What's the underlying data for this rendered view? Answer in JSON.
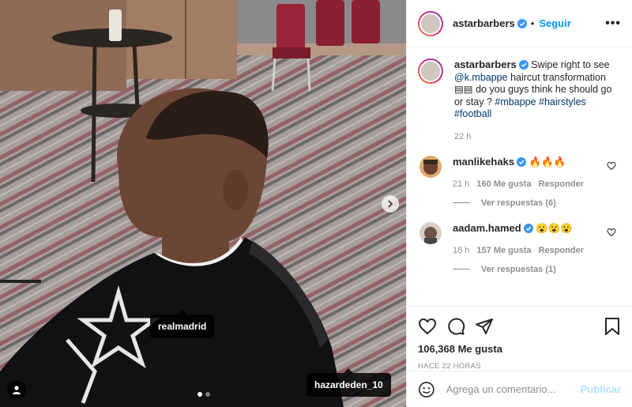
{
  "post": {
    "author": "astarbarbers",
    "follow_label": "Seguir",
    "more_label": "•••",
    "caption_prefix": "Swipe right to see",
    "caption_mention": "@k.mbappe",
    "caption_middle": "haircut transformation",
    "caption_emoji": "▤▤",
    "caption_rest": "do you guys think he should go or stay ?",
    "caption_tags": [
      "#mbappe",
      "#hairstyles",
      "#football"
    ],
    "caption_time": "22 h",
    "likes_label": "106,368 Me gusta",
    "posted_ago": "HACE 22 HORAS",
    "photo_tags": [
      "realmadrid",
      "hazardeden_10"
    ],
    "carousel": {
      "current": 1,
      "total": 2
    }
  },
  "comments": [
    {
      "user": "manlikehaks",
      "text": "🔥🔥🔥",
      "time": "21 h",
      "likes": "160 Me gusta",
      "reply_label": "Responder",
      "replies_label": "Ver respuestas (6)"
    },
    {
      "user": "aadam.hamed",
      "text": "😮😮😮",
      "time": "18 h",
      "likes": "157 Me gusta",
      "reply_label": "Responder",
      "replies_label": "Ver respuestas (1)"
    }
  ],
  "composer": {
    "placeholder": "Agrega un comentario...",
    "publish_label": "Publicar"
  },
  "icons": [
    "verified-icon",
    "heart-icon",
    "comment-icon",
    "share-icon",
    "bookmark-icon",
    "emoji-icon",
    "chevron-right-icon",
    "user-tag-icon"
  ],
  "colors": {
    "link": "#00376b",
    "follow": "#0095f6",
    "publish_disabled": "#b2dffc",
    "verified": "#3897f0"
  }
}
